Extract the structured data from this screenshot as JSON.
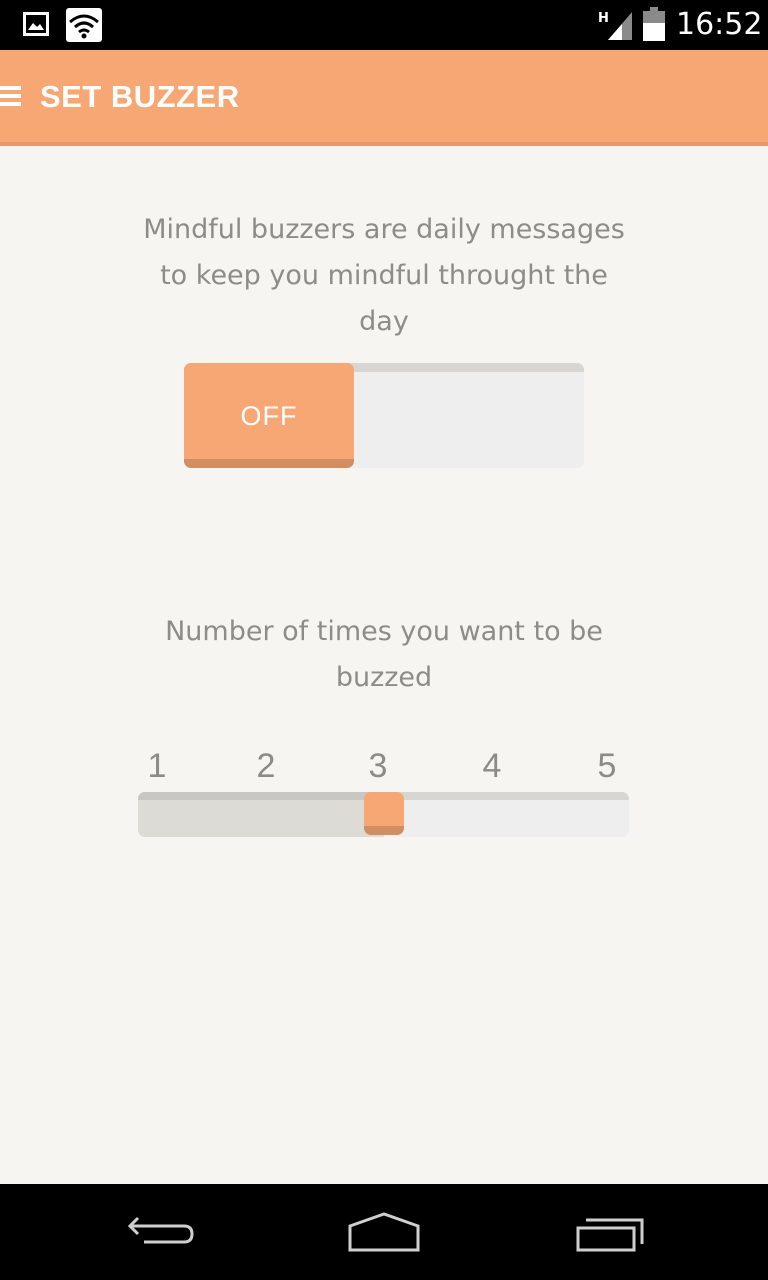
{
  "status_bar": {
    "time": "16:52",
    "network_label": "H",
    "icons": [
      "gallery-icon",
      "wifi-icon",
      "signal-icon",
      "battery-icon"
    ]
  },
  "app_bar": {
    "title": "SET BUZZER",
    "menu_icon": "menu-icon"
  },
  "buzzer": {
    "description": "Mindful buzzers are daily messages to keep you mindful throught the day",
    "toggle_label": "OFF",
    "enabled": false
  },
  "frequency": {
    "caption": "Number of times you want to be buzzed",
    "ticks": [
      "1",
      "2",
      "3",
      "4",
      "5"
    ],
    "selected_value": 3
  },
  "nav_bar": {
    "buttons": [
      "back-icon",
      "home-icon",
      "recent-apps-icon"
    ]
  },
  "colors": {
    "accent": "#f6a774",
    "accent_dark": "#d08e61",
    "background": "#f6f5f2",
    "text": "#8d8c88",
    "track": "#eeeeee"
  }
}
